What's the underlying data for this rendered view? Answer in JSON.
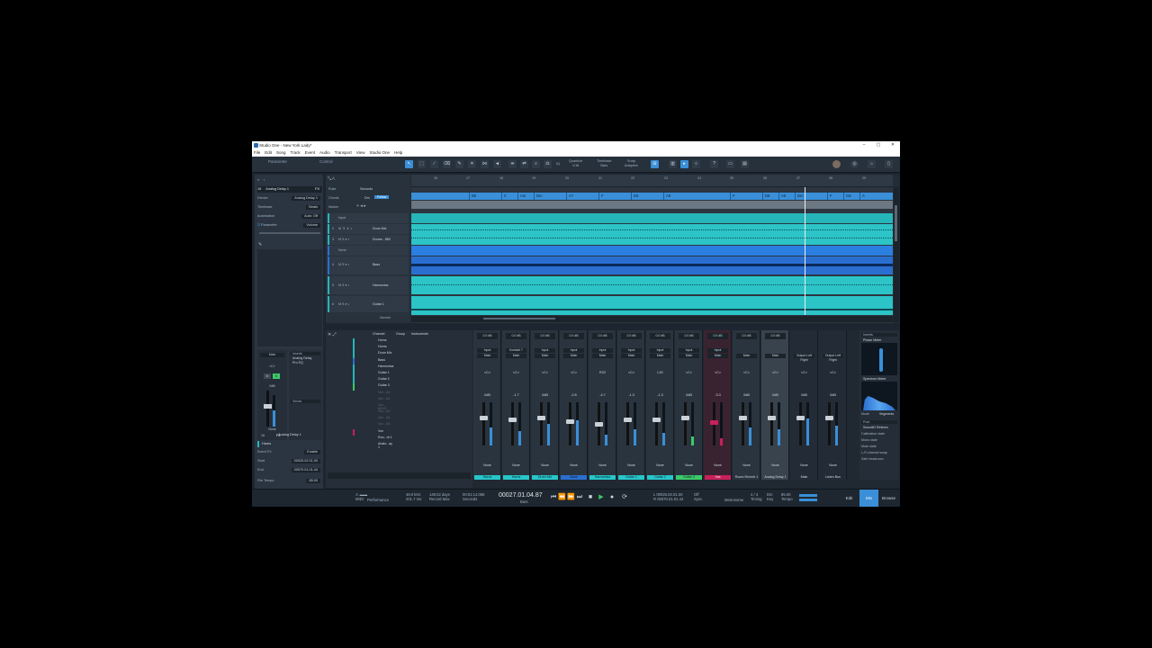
{
  "window": {
    "title": "Studio One - New York Lady*",
    "controls": [
      "–",
      "▢",
      "✕"
    ]
  },
  "menu": [
    "File",
    "Edit",
    "Song",
    "Track",
    "Event",
    "Audio",
    "Transport",
    "View",
    "Studio One",
    "Help"
  ],
  "toolbar": {
    "tabs": [
      "Parameter",
      "Control"
    ],
    "quantize_label": "Quantize",
    "quantize_value": "1/16",
    "timebase_label": "Timebase",
    "timebase_value": "Bars",
    "snap_label": "Snap",
    "snap_value": "Adaptive",
    "iq_label": "IQ"
  },
  "inspector": {
    "track_number": "16",
    "track_name": "Analog Delay 1",
    "fx_label": "FX",
    "rows": [
      {
        "label": "Device",
        "value": "Analog Delay 1"
      },
      {
        "label": "Timebase",
        "value": "Beats"
      },
      {
        "label": "Automation",
        "value": "Auto: Off"
      },
      {
        "label": "Parameter",
        "value": "Volume"
      }
    ],
    "channel_out": "Main",
    "channel_db": "0dB",
    "channel_value": "<C>",
    "inserts_label": "Inserts",
    "inserts": [
      "Analog Delay",
      "Pro EQ"
    ],
    "sends_label": "Sends",
    "none_label": "None",
    "strip_num": "16",
    "strip_name": "Analog Delay 1",
    "event_track": "Horns",
    "event_fx_label": "Event FX",
    "event_fx_value": "Enable",
    "start_label": "Start",
    "start_value": "00025.02.01.00",
    "end_label": "End",
    "end_value": "00070.01.01.44",
    "file_tempo_label": "File Tempo",
    "file_tempo_value": "85.00"
  },
  "arrange": {
    "ruler_label": "Ruler",
    "ruler_value": "Seconds",
    "chords_label": "Chords",
    "chords_key": "Dm",
    "chords_follow": "Follow",
    "marker_label": "Marker",
    "bars": [
      "16",
      "17",
      "18",
      "19",
      "20",
      "21",
      "22",
      "23",
      "24",
      "25",
      "26",
      "27",
      "28",
      "29"
    ],
    "chords": [
      "Bb",
      "C",
      "Am",
      "Dm",
      "A7",
      "F",
      "D9",
      "A9",
      "F",
      "D9",
      "A9",
      "Dm",
      "F",
      "G6",
      "A"
    ],
    "tracks": [
      {
        "num": "",
        "name": "Input"
      },
      {
        "num": "2",
        "name": "Drum Mix"
      },
      {
        "num": "3",
        "name": "Drums - 850"
      },
      {
        "num": "",
        "name": "None"
      },
      {
        "num": "4",
        "name": "Bass"
      },
      {
        "num": "5",
        "name": "Harmonica"
      },
      {
        "num": "6",
        "name": "Guitar 1"
      }
    ],
    "footer_mode": "Normal"
  },
  "mixer": {
    "browser_tabs": [
      "Channel",
      "Group",
      "Instruments"
    ],
    "channels": [
      "Horns",
      "Horns",
      "Drum Mix",
      "Bass",
      "Harmonica",
      "Guitar 1",
      "Guitar 2",
      "Guitar 3",
      "Vox - A1",
      "Vox - A2",
      "Vox - BGV1",
      "Vox - A3",
      "Vox - A4",
      "Vox - A5",
      "Vox",
      "Roo...rb 1",
      "Analo...ay 1"
    ],
    "strips": [
      {
        "name": "Horns",
        "db": "0dB",
        "color": "#26c6c9",
        "input": "Input",
        "top": "0.0 dB",
        "pan": "<C>"
      },
      {
        "name": "Horns",
        "db": "-1.7",
        "color": "#26c6c9",
        "input": "Kontakt 7",
        "top": "0.0 dB",
        "pan": "<C>"
      },
      {
        "name": "Drum Mix",
        "db": "0dB",
        "color": "#26c6c9",
        "input": "Input",
        "top": "0.0 dB",
        "pan": "<C>"
      },
      {
        "name": "Bass",
        "db": "-2.6",
        "color": "#2a6fd0",
        "input": "Input",
        "top": "0.0 dB",
        "pan": "<C>"
      },
      {
        "name": "Harmonica",
        "db": "-4.7",
        "color": "#26c6c9",
        "input": "Input",
        "top": "0.0 dB",
        "pan": "R22"
      },
      {
        "name": "Guitar 1",
        "db": "-1.3",
        "color": "#26c6c9",
        "input": "Input",
        "top": "0.0 dB",
        "pan": "<C>"
      },
      {
        "name": "Guitar 2",
        "db": "-1.3",
        "color": "#26c6c9",
        "input": "Input",
        "top": "0.0 dB",
        "pan": "L20"
      },
      {
        "name": "Guitar 3",
        "db": "0dB",
        "color": "#3cc96a",
        "input": "Input",
        "top": "0.0 dB",
        "pan": "<C>"
      },
      {
        "name": "Vox",
        "db": "-3.3",
        "color": "#c8215a",
        "input": "Input",
        "top": "0.0 dB",
        "pan": "<C>"
      },
      {
        "name": "Room Reverb 1",
        "db": "0dB",
        "color": "#2a343f",
        "input": "",
        "top": "0.0 dB",
        "pan": "<C>"
      },
      {
        "name": "Analog Delay 1",
        "db": "0dB",
        "color": "#2a343f",
        "input": "",
        "top": "0.0 dB",
        "pan": "<C>"
      },
      {
        "name": "Main",
        "db": "0dB",
        "color": "#2a343f",
        "input": "Output Left Right",
        "top": "",
        "pan": "<C>"
      },
      {
        "name": "Listen Bus",
        "db": "0dB",
        "color": "#2a343f",
        "input": "Output Left Right",
        "top": "",
        "pan": "<C>"
      }
    ],
    "main_out": "Main",
    "none_label": "None",
    "audio_off": "Audio Off",
    "right_panel": {
      "inserts": "Inserts",
      "plugin1": "Phase Meter",
      "plugin2": "Spectrum Meter",
      "mode": "Mode",
      "mode_value": "Segments",
      "post": "Post",
      "plugin3": "SoundID Referen",
      "rows": [
        "Calibration state",
        "Mono state",
        "Mute state",
        "L-R channel swap",
        "Safe headroom"
      ]
    }
  },
  "transport": {
    "midi": "MIDI",
    "performance": "Performance",
    "sample_rate": "48.0 kHz",
    "latency": "201.7 ms",
    "record_max_value": "149:22 days",
    "record_max_label": "Record Max",
    "seconds_value": "00:01:14.085",
    "seconds_label": "Seconds",
    "position": "00027.01.04.87",
    "position_label": "Bars",
    "left_locator": "L 00025.02.01.00",
    "right_locator": "R 00070.01.01.44",
    "sync_value": "Off",
    "sync_label": "Sync",
    "metronome_label": "Metronome",
    "timing_value": "4 / 4",
    "timing_label": "Timing",
    "key_value": "Dm",
    "key_label": "Key",
    "tempo_value": "85.00",
    "tempo_label": "Tempo",
    "nav": [
      "Edit",
      "Mix",
      "Browse"
    ]
  }
}
